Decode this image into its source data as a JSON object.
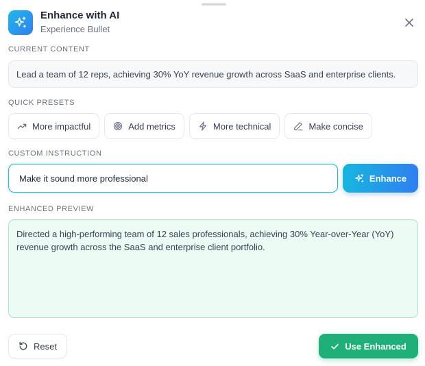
{
  "header": {
    "title": "Enhance with AI",
    "subtitle": "Experience Bullet",
    "icon": "sparkles-icon",
    "close_icon": "close-icon"
  },
  "current_content": {
    "label": "CURRENT CONTENT",
    "text": "Lead a team of 12 reps, achieving 30% YoY revenue growth across SaaS and enterprise clients."
  },
  "quick_presets": {
    "label": "QUICK PRESETS",
    "items": [
      {
        "label": "More impactful",
        "icon": "trending-up-icon"
      },
      {
        "label": "Add metrics",
        "icon": "target-icon"
      },
      {
        "label": "More technical",
        "icon": "lightning-icon"
      },
      {
        "label": "Make concise",
        "icon": "pencil-icon"
      }
    ]
  },
  "custom_instruction": {
    "label": "CUSTOM INSTRUCTION",
    "value": "Make it sound more professional",
    "button_label": "Enhance"
  },
  "enhanced_preview": {
    "label": "ENHANCED PREVIEW",
    "text": "Directed a high-performing team of 12 sales professionals, achieving 30% Year-over-Year (YoY) revenue growth across the SaaS and enterprise client portfolio."
  },
  "footer": {
    "reset_label": "Reset",
    "use_label": "Use Enhanced"
  },
  "colors": {
    "accent_gradient_start": "#17b6df",
    "accent_gradient_end": "#2f7ff0",
    "success": "#1fb07a",
    "preview_bg": "#ecfbf3"
  }
}
